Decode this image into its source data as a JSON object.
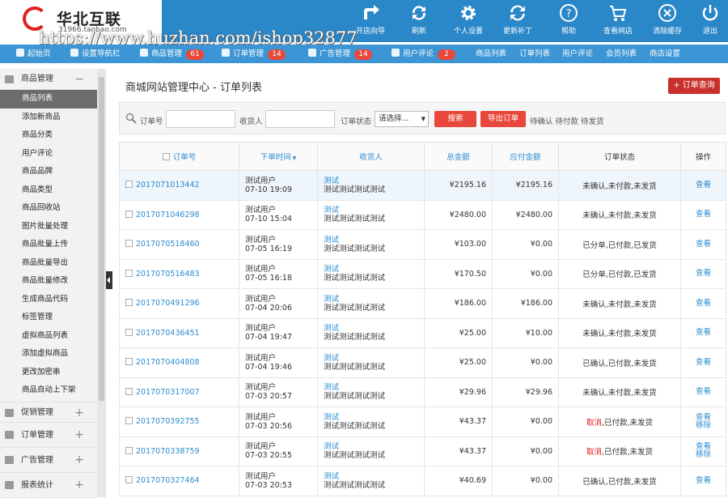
{
  "logo": {
    "name": "华北互联",
    "sub": "31966.taobao.com"
  },
  "watermark": "https://www.huzhan.com/ishop32877",
  "toolbar": [
    {
      "icon": "arrow-right-icon",
      "label": "开店向导"
    },
    {
      "icon": "refresh-icon",
      "label": "刷新"
    },
    {
      "icon": "gear-icon",
      "label": "个人设置"
    },
    {
      "icon": "update-icon",
      "label": "更新补丁"
    },
    {
      "icon": "help-icon",
      "label": "帮助"
    },
    {
      "icon": "cart-icon",
      "label": "查看网店"
    },
    {
      "icon": "clear-icon",
      "label": "清除缓存"
    },
    {
      "icon": "power-icon",
      "label": "退出"
    }
  ],
  "nav": {
    "home": "起始页",
    "nav_setting": "设置导航栏",
    "goods": "商品管理",
    "goods_count": "61",
    "orders": "订单管理",
    "orders_count": "14",
    "ads": "广告管理",
    "ads_count": "14",
    "comments": "用户评论",
    "comments_count": "2",
    "goods_list": "商品列表",
    "order_list": "订单列表",
    "user_comments": "用户评论",
    "members": "会员列表",
    "shop_settings": "商店设置"
  },
  "sidebar": {
    "group_goods": "商品管理",
    "items": [
      "商品列表",
      "添加新商品",
      "商品分类",
      "用户评论",
      "商品品牌",
      "商品类型",
      "商品回收站",
      "图片批量处理",
      "商品批量上传",
      "商品批量导出",
      "商品批量修改",
      "生成商品代码",
      "标签管理",
      "虚拟商品列表",
      "添加虚拟商品",
      "更改加密串",
      "商品自动上下架"
    ],
    "group_promo": "促销管理",
    "group_orders": "订单管理",
    "group_ads": "广告管理",
    "group_reports": "报表统计"
  },
  "page": {
    "title": "商城网站管理中心 - 订单列表",
    "query_button": "+ 订单查询"
  },
  "filter": {
    "order_no_label": "订单号",
    "consignee_label": "收货人",
    "status_label": "订单状态",
    "status_value": "请选择...",
    "search_button": "搜索",
    "export_button": "导出订单",
    "quick_links": "待确认 待付款 待发货"
  },
  "table": {
    "headers": [
      "订单号",
      "下单时间",
      "收货人",
      "总金额",
      "应付金额",
      "订单状态",
      "操作"
    ],
    "rows": [
      {
        "id": "2017071013442",
        "user": "测试用户",
        "time": "07-10 19:09",
        "name": "测试",
        "addr": "测试测试测试测试",
        "total": "¥2195.16",
        "due": "¥2195.16",
        "status": "未确认,未付款,未发货",
        "op": "查看"
      },
      {
        "id": "2017071046298",
        "user": "测试用户",
        "time": "07-10 15:04",
        "name": "测试",
        "addr": "测试测试测试测试",
        "total": "¥2480.00",
        "due": "¥2480.00",
        "status": "未确认,未付款,未发货",
        "op": "查看"
      },
      {
        "id": "2017070518460",
        "user": "测试用户",
        "time": "07-05 16:19",
        "name": "测试",
        "addr": "测试测试测试测试",
        "total": "¥103.00",
        "due": "¥0.00",
        "status": "已分单,已付款,已发货",
        "op": "查看"
      },
      {
        "id": "2017070516483",
        "user": "测试用户",
        "time": "07-05 16:18",
        "name": "测试",
        "addr": "测试测试测试测试",
        "total": "¥170.50",
        "due": "¥0.00",
        "status": "已分单,已付款,已发货",
        "op": "查看"
      },
      {
        "id": "2017070491296",
        "user": "测试用户",
        "time": "07-04 20:06",
        "name": "测试",
        "addr": "测试测试测试测试",
        "total": "¥186.00",
        "due": "¥186.00",
        "status": "未确认,未付款,未发货",
        "op": "查看"
      },
      {
        "id": "2017070436451",
        "user": "测试用户",
        "time": "07-04 19:47",
        "name": "测试",
        "addr": "测试测试测试测试",
        "total": "¥25.00",
        "due": "¥10.00",
        "status": "未确认,未付款,未发货",
        "op": "查看"
      },
      {
        "id": "2017070404808",
        "user": "测试用户",
        "time": "07-04 19:46",
        "name": "测试",
        "addr": "测试测试测试测试",
        "total": "¥25.00",
        "due": "¥0.00",
        "status": "已确认,已付款,未发货",
        "op": "查看"
      },
      {
        "id": "2017070317007",
        "user": "测试用户",
        "time": "07-03 20:57",
        "name": "测试",
        "addr": "测试测试测试测试",
        "total": "¥29.96",
        "due": "¥29.96",
        "status": "未确认,未付款,未发货",
        "op": "查看"
      },
      {
        "id": "2017070392755",
        "user": "测试用户",
        "time": "07-03 20:56",
        "name": "测试",
        "addr": "测试测试测试测试",
        "total": "¥43.37",
        "due": "¥0.00",
        "status_cancel": "取消",
        "status_rest": ",已付款,未发货",
        "op": "查看",
        "op2": "移除"
      },
      {
        "id": "2017070338759",
        "user": "测试用户",
        "time": "07-03 20:55",
        "name": "测试",
        "addr": "测试测试测试测试",
        "total": "¥43.37",
        "due": "¥0.00",
        "status_cancel": "取消",
        "status_rest": ",已付款,未发货",
        "op": "查看",
        "op2": "移除"
      },
      {
        "id": "2017070327464",
        "user": "测试用户",
        "time": "07-03 20:53",
        "name": "测试",
        "addr": "测试测试测试测试",
        "total": "¥40.69",
        "due": "¥0.00",
        "status": "已确认,已付款,未发货",
        "op": "查看"
      }
    ]
  },
  "colors": {
    "header_blue": "#2a87c8",
    "nav_blue": "#3c95d4",
    "accent_red": "#e8473b",
    "link_blue": "#2a8bd0"
  }
}
